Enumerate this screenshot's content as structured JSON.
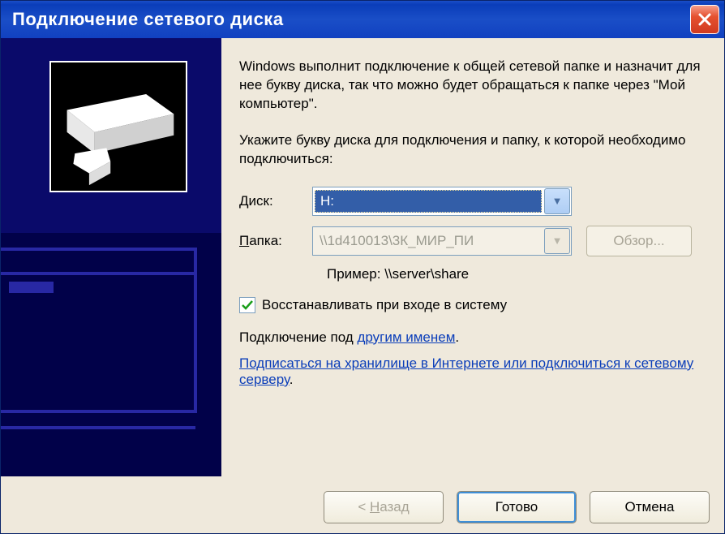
{
  "title": "Подключение сетевого диска",
  "main_text_1": "Windows выполнит подключение к общей сетевой папке и назначит для нее букву диска, так что можно будет обращаться к папке через \"Мой компьютер\".",
  "main_text_2": "Укажите букву диска для подключения и папку, к которой необходимо подключиться:",
  "drive_label_pre": "Д",
  "drive_label_post": "иск:",
  "drive_value": "H:",
  "folder_label_pre": "П",
  "folder_label_post": "апка:",
  "folder_value": "\\\\1d410013\\3К_МИР_ПИ",
  "browse_pre": "О",
  "browse_post": "бзор...",
  "example": "Пример: \\\\server\\share",
  "reconnect_pre": "В",
  "reconnect_post": "осстанавливать при входе в систему",
  "connect_as_pre": "Подключение под ",
  "connect_as_link": "другим именем",
  "signup_link": "Подписаться на хранилище в Интернете или подключиться к сетевому серверу",
  "back_pre": "< ",
  "back_u": "Н",
  "back_post": "азад",
  "finish": "Готово",
  "cancel": "Отмена"
}
